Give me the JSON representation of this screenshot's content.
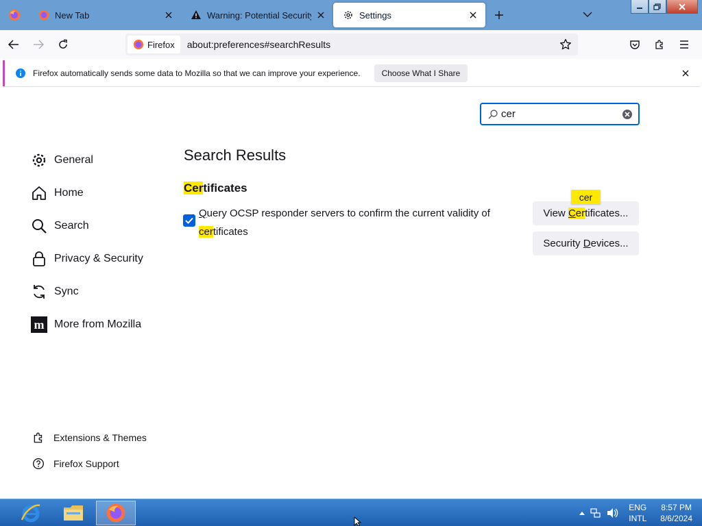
{
  "tabs": [
    {
      "title": "New Tab"
    },
    {
      "title": "Warning: Potential Security Risk"
    },
    {
      "title": "Settings"
    }
  ],
  "navbar": {
    "identity_label": "Firefox",
    "url": "about:preferences#searchResults"
  },
  "notification": {
    "text": "Firefox automatically sends some data to Mozilla so that we can improve your experience.",
    "button": "Choose What I Share"
  },
  "search": {
    "value": "cer"
  },
  "sidebar": {
    "items": [
      {
        "label": "General",
        "icon": "gear-icon"
      },
      {
        "label": "Home",
        "icon": "home-icon"
      },
      {
        "label": "Search",
        "icon": "search-icon"
      },
      {
        "label": "Privacy & Security",
        "icon": "lock-icon"
      },
      {
        "label": "Sync",
        "icon": "sync-icon"
      },
      {
        "label": "More from Mozilla",
        "icon": "mozilla-icon"
      }
    ],
    "bottom": [
      {
        "label": "Extensions & Themes",
        "icon": "puzzle-icon"
      },
      {
        "label": "Firefox Support",
        "icon": "help-icon"
      }
    ]
  },
  "main": {
    "heading": "Search Results",
    "section_title_hl": "Cer",
    "section_title_rest": "tificates",
    "checkbox": {
      "checked": true,
      "label_accesskey": "Q",
      "label_line1_rest": "uery OCSP responder servers to confirm the current validity of",
      "label_line2_hl": "cer",
      "label_line2_rest": "tificates"
    },
    "view_button": {
      "pre": "View ",
      "hl_u": "C",
      "hl": "er",
      "post": "tificates..."
    },
    "devices_button": {
      "pre": "Security ",
      "u": "D",
      "post": "evices..."
    },
    "tooltip": "cer"
  },
  "taskbar": {
    "lang_top": "ENG",
    "lang_bottom": "INTL",
    "time": "8:57 PM",
    "date": "8/6/2024"
  },
  "colors": {
    "accent": "#0061e0",
    "highlight": "#ffe900",
    "tabbar": "#6b9ed2"
  }
}
